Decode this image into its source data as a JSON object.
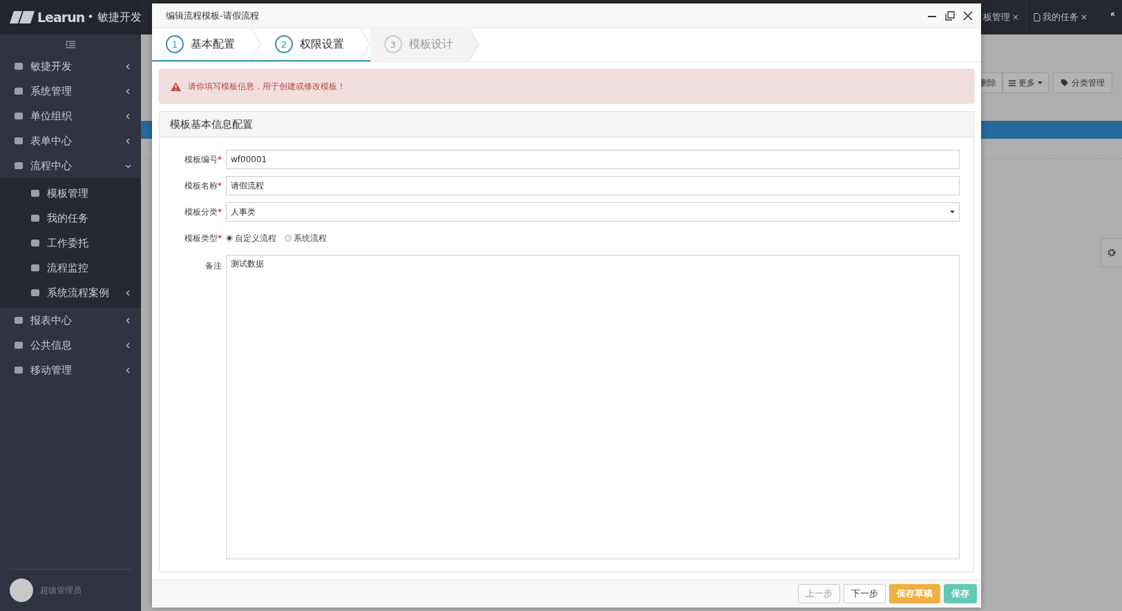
{
  "app": {
    "logo_word": "Learun",
    "logo_suffix": "• 敏捷开发"
  },
  "sidebar": {
    "items": [
      {
        "label": "敏捷开发",
        "expanded": false
      },
      {
        "label": "系统管理",
        "expanded": false
      },
      {
        "label": "单位组织",
        "expanded": false
      },
      {
        "label": "表单中心",
        "expanded": false
      },
      {
        "label": "流程中心",
        "expanded": true,
        "children": [
          {
            "label": "模板管理",
            "kind": "link"
          },
          {
            "label": "我的任务",
            "kind": "link"
          },
          {
            "label": "工作委托",
            "kind": "link"
          },
          {
            "label": "流程监控",
            "kind": "link"
          },
          {
            "label": "系统流程案例",
            "kind": "group",
            "expanded": false
          }
        ]
      },
      {
        "label": "报表中心",
        "expanded": false
      },
      {
        "label": "公共信息",
        "expanded": false
      },
      {
        "label": "移动管理",
        "expanded": false
      }
    ],
    "user": "超级管理员"
  },
  "tabs": [
    {
      "label": "板管理",
      "close": "×",
      "has_icon": false
    },
    {
      "label": "我的任务",
      "close": "×",
      "has_icon": true
    }
  ],
  "toolbar": [
    {
      "label": "删除",
      "kind": "plain"
    },
    {
      "label": "更多",
      "kind": "menu"
    },
    {
      "label": "分类管理",
      "kind": "tag"
    }
  ],
  "modal": {
    "title": "编辑流程模板-请假流程",
    "steps": [
      {
        "number": "1",
        "label": "基本配置",
        "disabled": false
      },
      {
        "number": "2",
        "label": "权限设置",
        "disabled": false
      },
      {
        "number": "3",
        "label": "模板设计",
        "disabled": true
      }
    ],
    "alert": "请你填写模板信息，用于创建或修改模板！",
    "panel_title": "模板基本信息配置",
    "fields": [
      {
        "label": "模板编号",
        "required_mark": "*",
        "kind": "text",
        "value": "wf00001"
      },
      {
        "label": "模板名称",
        "required_mark": "*",
        "kind": "text",
        "value": "请假流程"
      },
      {
        "label": "模板分类",
        "required_mark": "*",
        "kind": "select",
        "value": "人事类"
      },
      {
        "label": "模板类型",
        "required_mark": "*",
        "kind": "radio",
        "options": [
          {
            "label": "自定义流程",
            "selected": true
          },
          {
            "label": "系统流程",
            "selected": false
          }
        ]
      },
      {
        "label": "备注",
        "kind": "textarea",
        "value": "测试数据"
      }
    ],
    "buttons": [
      {
        "label": "上一步",
        "kind": "default",
        "disabled": true
      },
      {
        "label": "下一步",
        "kind": "default",
        "disabled": false
      },
      {
        "label": "保存草稿",
        "kind": "warning",
        "disabled": false
      },
      {
        "label": "保存",
        "kind": "success",
        "disabled": false
      }
    ]
  }
}
